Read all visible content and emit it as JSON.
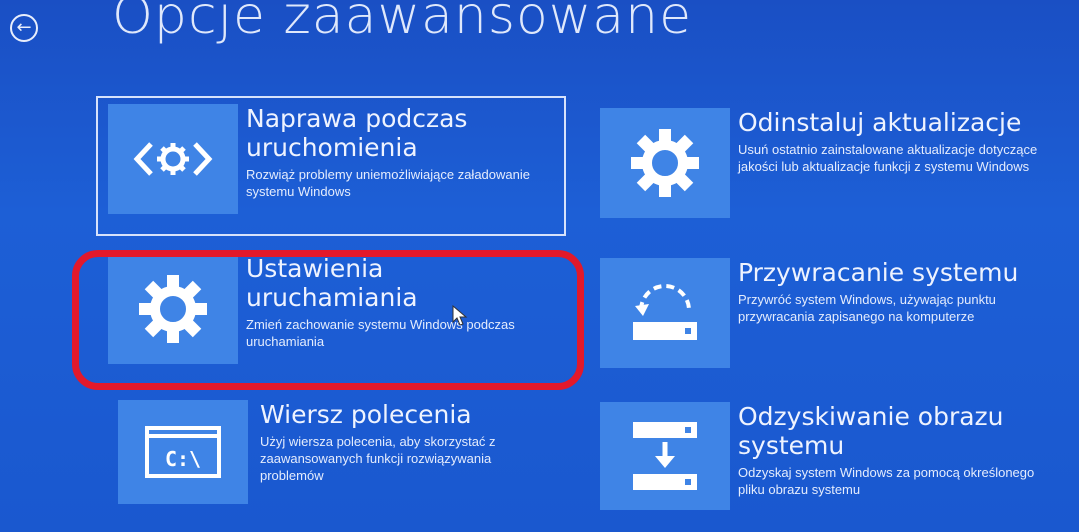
{
  "header": {
    "back_icon": "back-arrow-icon",
    "title": "Opcje zaawansowane"
  },
  "options": [
    {
      "icon": "startup-repair-icon",
      "title_line1": "Naprawa podczas",
      "title_line2": "uruchomienia",
      "description": "Rozwiąż problemy uniemożliwiające załadowanie systemu Windows",
      "selected": true
    },
    {
      "icon": "gear-icon",
      "title_line1": "Odinstaluj aktualizacje",
      "title_line2": "",
      "description": "Usuń ostatnio zainstalowane aktualizacje dotyczące jakości lub aktualizacje funkcji z systemu Windows"
    },
    {
      "icon": "gear-icon",
      "title_line1": "Ustawienia",
      "title_line2": "uruchamiania",
      "description": "Zmień zachowanie systemu Windows podczas uruchamiania",
      "highlighted": true
    },
    {
      "icon": "system-restore-icon",
      "title_line1": "Przywracanie systemu",
      "title_line2": "",
      "description": "Przywróć system Windows, używając punktu przywracania zapisanego na komputerze"
    },
    {
      "icon": "command-prompt-icon",
      "icon_text": "C:\\",
      "title_line1": "Wiersz polecenia",
      "title_line2": "",
      "description": "Użyj wiersza polecenia, aby skorzystać z zaawansowanych funkcji rozwiązywania problemów"
    },
    {
      "icon": "system-image-icon",
      "title_line1": "Odzyskiwanie obrazu",
      "title_line2": "systemu",
      "description": "Odzyskaj system Windows za pomocą określonego pliku obrazu systemu"
    }
  ],
  "colors": {
    "background": "#1d5fd6",
    "tile": "#3f84e6",
    "highlight": "#e2192b"
  }
}
